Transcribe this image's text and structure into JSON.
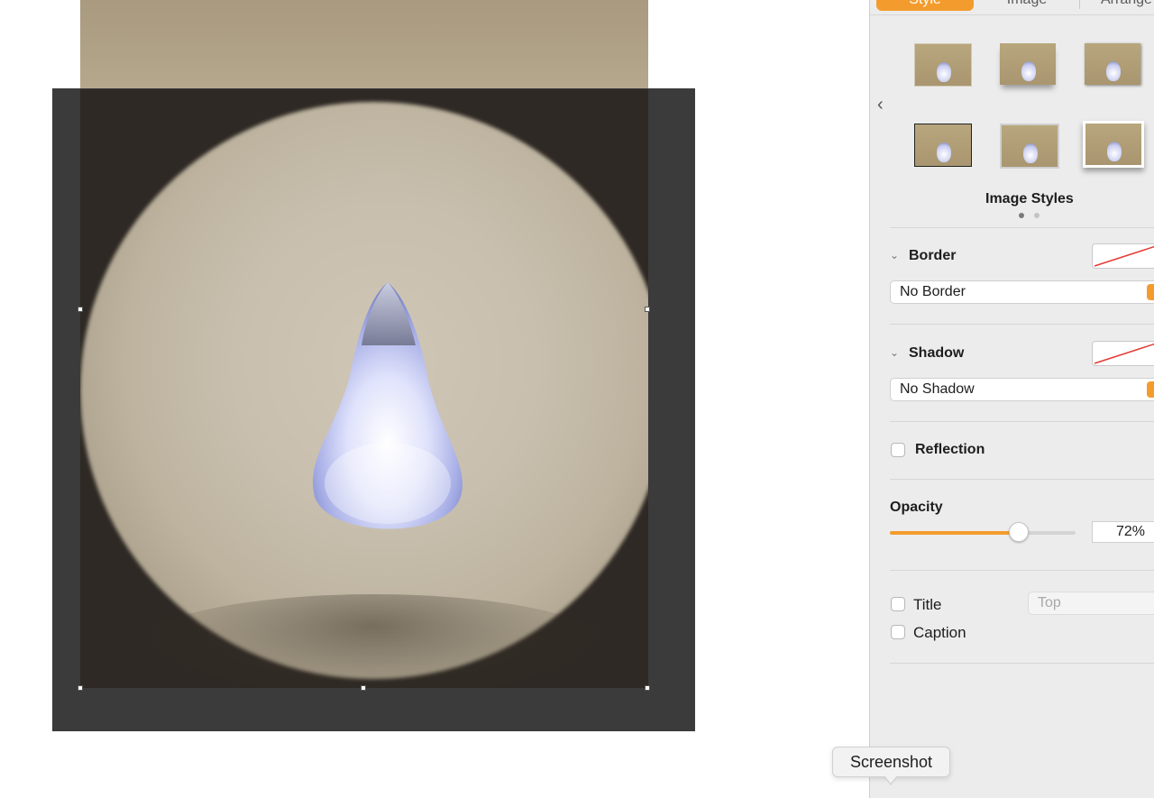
{
  "inspector": {
    "tabs": [
      {
        "label": "Style",
        "active": true
      },
      {
        "label": "Image",
        "active": false
      },
      {
        "label": "Arrange",
        "active": false
      }
    ],
    "image_styles": {
      "title": "Image Styles",
      "page": 1,
      "pages": 2,
      "prev_icon": "chevron-left-icon"
    },
    "border": {
      "title": "Border",
      "value": "No Border"
    },
    "shadow": {
      "title": "Shadow",
      "value": "No Shadow"
    },
    "reflection": {
      "label": "Reflection",
      "checked": false
    },
    "opacity": {
      "title": "Opacity",
      "value_label": "72%",
      "value": 0.72
    },
    "title_option": {
      "label": "Title",
      "checked": false,
      "position": "Top"
    },
    "caption_option": {
      "label": "Caption",
      "checked": false
    }
  },
  "tooltip": {
    "text": "Screenshot"
  },
  "colors": {
    "accent": "#f39c2d",
    "canvas_mask": "#3b3b3b",
    "inspector_bg": "#ececec"
  }
}
